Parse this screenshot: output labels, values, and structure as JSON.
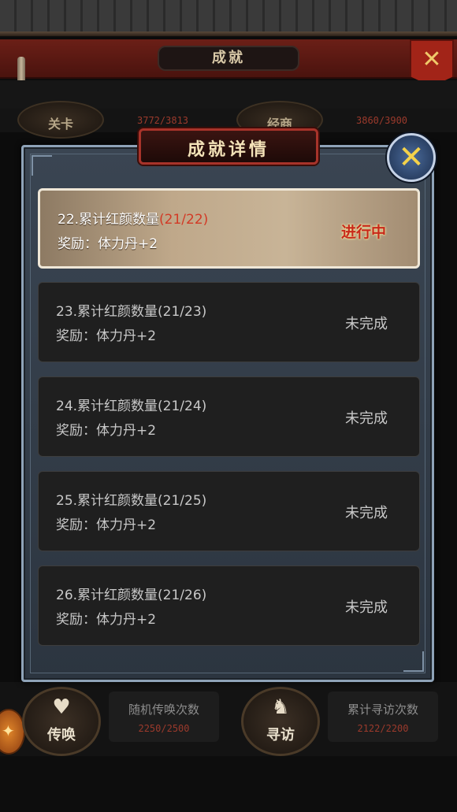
{
  "header": {
    "title": "成就",
    "close_icon": "close-icon"
  },
  "background_categories": [
    {
      "label": "关卡",
      "count": "3772/3813"
    },
    {
      "label": "经商",
      "count": "3860/3900"
    }
  ],
  "bottom_categories": [
    {
      "label": "传唤",
      "icon": "heart-icon",
      "description": "随机传唤次数",
      "count": "2250/2500"
    },
    {
      "label": "寻访",
      "icon": "horse-icon",
      "description": "累计寻访次数",
      "count": "2122/2200"
    }
  ],
  "modal": {
    "title": "成就详情",
    "close_icon": "close-icon",
    "items": [
      {
        "title": "22.累计红颜数量",
        "progress": "(21/22)",
        "reward": "奖励：体力丹+2",
        "status": "进行中",
        "active": true
      },
      {
        "title": "23.累计红颜数量",
        "progress": "(21/23)",
        "reward": "奖励：体力丹+2",
        "status": "未完成",
        "active": false
      },
      {
        "title": "24.累计红颜数量",
        "progress": "(21/24)",
        "reward": "奖励：体力丹+2",
        "status": "未完成",
        "active": false
      },
      {
        "title": "25.累计红颜数量",
        "progress": "(21/25)",
        "reward": "奖励：体力丹+2",
        "status": "未完成",
        "active": false
      },
      {
        "title": "26.累计红颜数量",
        "progress": "(21/26)",
        "reward": "奖励：体力丹+2",
        "status": "未完成",
        "active": false
      }
    ]
  },
  "colors": {
    "progress_active": "#d23a26",
    "status_active": "#c8281a",
    "accent_red": "#a22418"
  }
}
